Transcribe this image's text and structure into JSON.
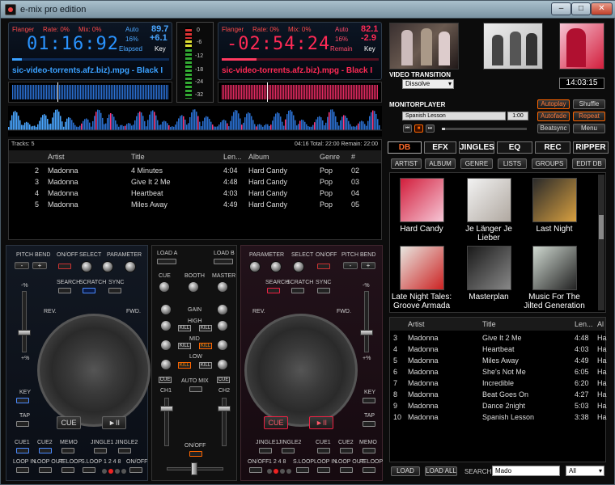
{
  "window": {
    "title": "e-mix pro edition",
    "controls": [
      "–",
      "□",
      "✕"
    ]
  },
  "deckA": {
    "flanger": "Flanger",
    "rate": "Rate: 0%",
    "mix": "Mix: 0%",
    "auto": "Auto",
    "bpm": "89.7",
    "pct": "16%",
    "pitch": "+6.1",
    "elapsed_label": "Elapsed",
    "key_label": "Key",
    "time": "01:16:92",
    "file": "sic-video-torrents.afz.biz).mpg - Black I",
    "color": "#1e8bff"
  },
  "deckB": {
    "flanger": "Flanger",
    "rate": "Rate: 0%",
    "mix": "Mix: 0%",
    "auto": "Auto",
    "bpm": "82.1",
    "pct": "16%",
    "pitch": "-2.9",
    "remain_label": "Remain",
    "key_label": "Key",
    "time": "-02:54:24",
    "file": "sic-video-torrents.afz.biz).mpg - Black I",
    "color": "#ff2a55"
  },
  "vu": {
    "marks": [
      "0",
      "-6",
      "-12",
      "-18",
      "-24",
      "-32"
    ]
  },
  "video": {
    "transition_label": "VIDEO TRANSITION",
    "transition_value": "Dissolve",
    "clock": "14:03:15"
  },
  "monitor": {
    "label": "MONITORPLAYER",
    "track": "Spanish Lesson",
    "time": "1:00",
    "buttons": [
      "Autoplay",
      "Shuffle",
      "Autofade",
      "Repeat",
      "Beatsync",
      "Menu"
    ]
  },
  "playlist": {
    "tracks_label": "Tracks: 5",
    "totals": "04:16 Total: 22:00 Remain: 22:00",
    "headers": [
      "Artist",
      "Title",
      "Len...",
      "Album",
      "Genre",
      "#"
    ],
    "rows": [
      {
        "n": "2",
        "artist": "Madonna",
        "title": "4 Minutes",
        "len": "4:04",
        "album": "Hard Candy",
        "genre": "Pop",
        "num": "02"
      },
      {
        "n": "3",
        "artist": "Madonna",
        "title": "Give It 2 Me",
        "len": "4:48",
        "album": "Hard Candy",
        "genre": "Pop",
        "num": "03"
      },
      {
        "n": "4",
        "artist": "Madonna",
        "title": "Heartbeat",
        "len": "4:03",
        "album": "Hard Candy",
        "genre": "Pop",
        "num": "04"
      },
      {
        "n": "5",
        "artist": "Madonna",
        "title": "Miles Away",
        "len": "4:49",
        "album": "Hard Candy",
        "genre": "Pop",
        "num": "05"
      }
    ]
  },
  "tabs": [
    "DB",
    "EFX",
    "JINGLES",
    "EQ",
    "REC",
    "RIPPER"
  ],
  "db_buttons": [
    "ARTIST",
    "ALBUM",
    "GENRE",
    "LISTS",
    "GROUPS",
    "EDIT DB"
  ],
  "albums": [
    {
      "title": "Hard Candy",
      "c1": "#d21e3c",
      "c2": "#f6c6d6"
    },
    {
      "title": "Je Länger Je Lieber",
      "c1": "#f2f2f2",
      "c2": "#b0a8a0"
    },
    {
      "title": "Last Night",
      "c1": "#2a2a2a",
      "c2": "#d8a040"
    },
    {
      "title": "Late Night Tales: Groove Armada",
      "c1": "#e8e6e0",
      "c2": "#c22"
    },
    {
      "title": "Masterplan",
      "c1": "#1a1a1a",
      "c2": "#888"
    },
    {
      "title": "Music For The Jilted Generation",
      "c1": "#cfd8d0",
      "c2": "#222"
    }
  ],
  "results": {
    "headers": [
      "Artist",
      "Title",
      "Len...",
      "Al"
    ],
    "rows": [
      {
        "n": "3",
        "artist": "Madonna",
        "title": "Give It 2 Me",
        "len": "4:48",
        "al": "Ha"
      },
      {
        "n": "4",
        "artist": "Madonna",
        "title": "Heartbeat",
        "len": "4:03",
        "al": "Ha"
      },
      {
        "n": "5",
        "artist": "Madonna",
        "title": "Miles Away",
        "len": "4:49",
        "al": "Ha"
      },
      {
        "n": "6",
        "artist": "Madonna",
        "title": "She's Not Me",
        "len": "6:05",
        "al": "Ha"
      },
      {
        "n": "7",
        "artist": "Madonna",
        "title": "Incredible",
        "len": "6:20",
        "al": "Ha"
      },
      {
        "n": "8",
        "artist": "Madonna",
        "title": "Beat Goes On",
        "len": "4:27",
        "al": "Ha"
      },
      {
        "n": "9",
        "artist": "Madonna",
        "title": "Dance 2night",
        "len": "5:03",
        "al": "Ha"
      },
      {
        "n": "10",
        "artist": "Madonna",
        "title": "Spanish Lesson",
        "len": "3:38",
        "al": "Ha"
      }
    ]
  },
  "bottom": {
    "load": "LOAD",
    "load_all": "LOAD ALL",
    "search_label": "SEARCH",
    "search_value": "Mado",
    "filter": "All"
  },
  "mixer": {
    "load_a": "LOAD A",
    "load_b": "LOAD B",
    "cue": "CUE",
    "booth": "BOOTH",
    "master": "MASTER",
    "gain": "GAIN",
    "high": "HIGH",
    "mid": "MID",
    "low": "LOW",
    "kill": "KILL",
    "auto_mix": "AUTO MIX",
    "ch1": "CH1",
    "ch2": "CH2",
    "onoff": "ON/OFF"
  },
  "leftDeck": {
    "pitch_bend": "PITCH BEND",
    "onoff": "ON/OFF",
    "select": "SELECT",
    "parameter": "PARAMETER",
    "search": "SEARCH",
    "scratch": "SCRATCH",
    "sync": "SYNC",
    "minus_pct": "-%",
    "plus_pct": "+%",
    "rev": "REV.",
    "fwd": "FWD.",
    "key": "KEY",
    "tap": "TAP",
    "cue": "CUE",
    "play": "►II",
    "cue1": "CUE1",
    "cue2": "CUE2",
    "memo": "MEMO",
    "jingle1": "JINGLE1",
    "jingle2": "JINGLE2",
    "loop_in": "LOOP IN",
    "loop_out": "LOOP OUT",
    "reloop": "RELOOP",
    "sloop": "S.LOOP",
    "loop_nums": "1 2 4 8",
    "pm": "- +"
  },
  "rightDeck": {
    "pitch_bend": "PITCH BEND",
    "onoff": "ON/OFF",
    "select": "SELECT",
    "parameter": "PARAMETER",
    "search": "SEARCH",
    "scratch": "SCRATCH",
    "sync": "SYNC",
    "minus_pct": "-%",
    "plus_pct": "+%",
    "rev": "REV.",
    "fwd": "FWD.",
    "key": "KEY",
    "tap": "TAP",
    "cue": "CUE",
    "play": "►II",
    "cue1": "CUE1",
    "cue2": "CUE2",
    "memo": "MEMO",
    "jingle1": "JINGLE1",
    "jingle2": "JINGLE2",
    "loop_in": "LOOP IN",
    "loop_out": "LOOP OUT",
    "reloop": "RELOOP",
    "sloop": "S.LOOP",
    "loop_nums": "1 2 4 8"
  }
}
